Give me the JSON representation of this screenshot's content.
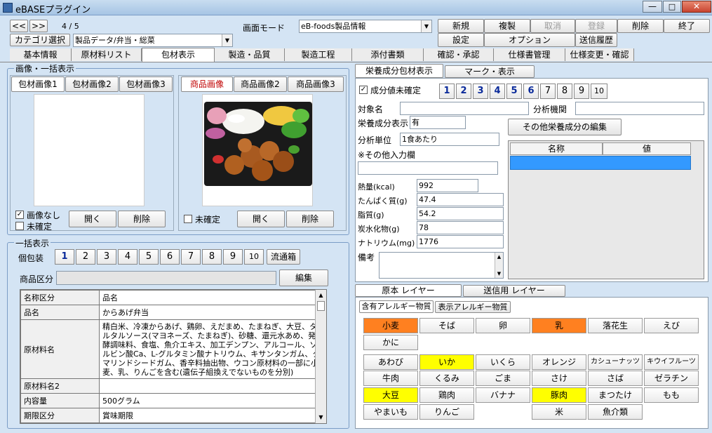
{
  "window": {
    "title": "eBASEプラグイン"
  },
  "nav": {
    "prev": "<<",
    "next": ">>",
    "counter": "4 / 5",
    "category_btn": "カテゴリ選択",
    "category_value": "製品データ/弁当・総菜"
  },
  "mode": {
    "label": "画面モード",
    "value": "eB-foods製品情報"
  },
  "toolbar": {
    "new": "新規",
    "copy": "複製",
    "cancel": "取消",
    "register": "登録",
    "delete": "削除",
    "finish": "終了",
    "settings": "設定",
    "options": "オプション",
    "history": "送信履歴"
  },
  "tabs": [
    "基本情報",
    "原材料リスト",
    "包材表示",
    "製造・品質",
    "製造工程",
    "添付書類",
    "確認・承認",
    "仕様書管理",
    "仕様変更・確認"
  ],
  "image_section": {
    "title": "画像・一括表示",
    "pkg_tabs": [
      "包材画像1",
      "包材画像2",
      "包材画像3"
    ],
    "prod_tabs": [
      "商品画像",
      "商品画像2",
      "商品画像3"
    ],
    "no_image": "画像なし",
    "unconfirmed": "未確定",
    "open": "開く",
    "delete": "削除",
    "prod_unconfirmed": "未確定"
  },
  "bulk": {
    "title": "一括表示",
    "indiv_label": "個包装",
    "numbers": [
      "1",
      "2",
      "3",
      "4",
      "5",
      "6",
      "7",
      "8",
      "9",
      "10"
    ],
    "distribution": "流通箱",
    "category_label": "商品区分",
    "edit": "編集",
    "rows": [
      {
        "k": "名称区分",
        "v": "品名"
      },
      {
        "k": "品名",
        "v": "からあげ弁当"
      },
      {
        "k": "原材料名",
        "v": "精白米、冷凍からあげ、鶏卵、えだまめ、たまねぎ、大豆、タルタルソース(マヨネーズ、たまねぎ)、砂糖、還元水あめ、発酵調味料、食塩、魚介エキス、加工デンプン、アルコール、ソルビン酸Ca、L-グルタミン酸ナトリウム、キサンタンガム、タマリンドシードガム、香辛料抽出物、ウコン原材料の一部に小麦、乳、りんごを含む(遺伝子組換えでないものを分別)"
      },
      {
        "k": "原材料名2",
        "v": ""
      },
      {
        "k": "内容量",
        "v": "500グラム"
      },
      {
        "k": "期限区分",
        "v": "賞味期限"
      }
    ]
  },
  "nutrition": {
    "tabs": [
      "栄養成分包材表示",
      "マーク・表示"
    ],
    "unconfirmed": "成分値未確定",
    "numbers": [
      "1",
      "2",
      "3",
      "4",
      "5",
      "6",
      "7",
      "8",
      "9",
      "10"
    ],
    "target_label": "対象名",
    "target_value": "",
    "agency_label": "分析機関",
    "agency_value": "",
    "display_label": "栄養成分表示",
    "display_value": "有",
    "unit_label": "分析単位",
    "unit_value": "1食あたり",
    "other_label": "※その他入力欄",
    "other_value": "",
    "edit_other": "その他栄養成分の編集",
    "col_name": "名称",
    "col_value": "値",
    "items": [
      {
        "label": "熱量(kcal)",
        "value": "992"
      },
      {
        "label": "たんぱく質(g)",
        "value": "47.4"
      },
      {
        "label": "脂質(g)",
        "value": "54.2"
      },
      {
        "label": "炭水化物(g)",
        "value": "78"
      },
      {
        "label": "ナトリウム(mg)",
        "value": "1776"
      }
    ],
    "notes_label": "備考",
    "notes_value": ""
  },
  "allergen": {
    "layer_tabs": [
      "原本 レイヤー",
      "送信用 レイヤー"
    ],
    "sub_tabs": [
      "含有アレルギー物質",
      "表示アレルギー物質"
    ],
    "row1": [
      {
        "name": "小麦",
        "color": "#ff8020"
      },
      {
        "name": "そば",
        "color": ""
      },
      {
        "name": "卵",
        "color": ""
      },
      {
        "name": "乳",
        "color": "#ff8020"
      },
      {
        "name": "落花生",
        "color": ""
      },
      {
        "name": "えび",
        "color": ""
      }
    ],
    "row1b": [
      {
        "name": "かに",
        "color": ""
      }
    ],
    "row2": [
      {
        "name": "あわび",
        "color": ""
      },
      {
        "name": "いか",
        "color": "#ffff00"
      },
      {
        "name": "いくら",
        "color": ""
      },
      {
        "name": "オレンジ",
        "color": ""
      },
      {
        "name": "カシューナッツ",
        "color": ""
      },
      {
        "name": "キウイフルーツ",
        "color": ""
      }
    ],
    "row3": [
      {
        "name": "牛肉",
        "color": ""
      },
      {
        "name": "くるみ",
        "color": ""
      },
      {
        "name": "ごま",
        "color": ""
      },
      {
        "name": "さけ",
        "color": ""
      },
      {
        "name": "さば",
        "color": ""
      },
      {
        "name": "ゼラチン",
        "color": ""
      }
    ],
    "row4": [
      {
        "name": "大豆",
        "color": "#ffff00"
      },
      {
        "name": "鶏肉",
        "color": ""
      },
      {
        "name": "バナナ",
        "color": ""
      },
      {
        "name": "豚肉",
        "color": "#ffff00"
      },
      {
        "name": "まつたけ",
        "color": ""
      },
      {
        "name": "もも",
        "color": ""
      }
    ],
    "row5": [
      {
        "name": "やまいも",
        "color": ""
      },
      {
        "name": "りんご",
        "color": ""
      },
      {
        "name": "",
        "color": ""
      },
      {
        "name": "米",
        "color": ""
      },
      {
        "name": "魚介類",
        "color": ""
      }
    ]
  }
}
